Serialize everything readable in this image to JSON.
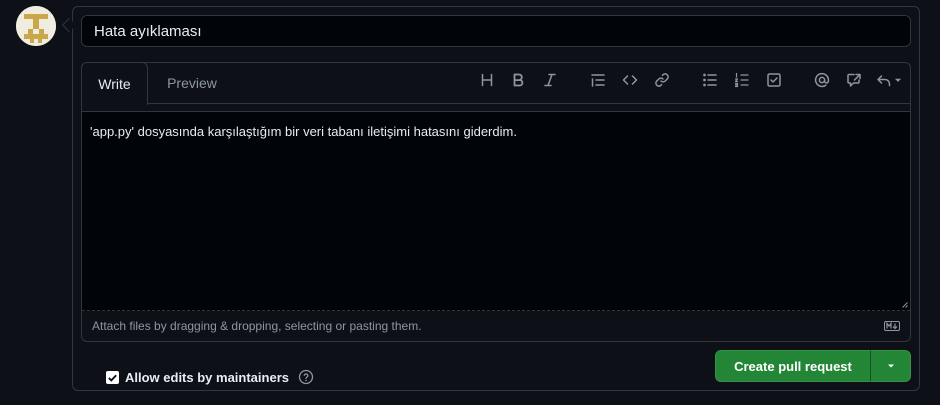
{
  "title_input": {
    "value": "Hata ayıklaması"
  },
  "tabs": [
    {
      "label": "Write",
      "active": true
    },
    {
      "label": "Preview",
      "active": false
    }
  ],
  "toolbar": {
    "icons": [
      "heading-icon",
      "bold-icon",
      "italic-icon",
      "quote-icon",
      "code-icon",
      "link-icon",
      "unordered-list-icon",
      "ordered-list-icon",
      "task-list-icon",
      "mention-icon",
      "reference-icon",
      "reply-icon"
    ]
  },
  "body": {
    "text": "'app.py' dosyasında karşılaştığım bir veri tabanı iletişimi hatasını giderdim."
  },
  "attach_hint": "Attach files by dragging & dropping, selecting or pasting them.",
  "allow_edits": {
    "label": "Allow edits by maintainers",
    "checked": true
  },
  "create_button": {
    "label": "Create pull request"
  },
  "colors": {
    "background": "#0d1117",
    "input_bg": "#010409",
    "border": "#30363d",
    "muted": "#8d96a0",
    "primary_green": "#238636"
  }
}
